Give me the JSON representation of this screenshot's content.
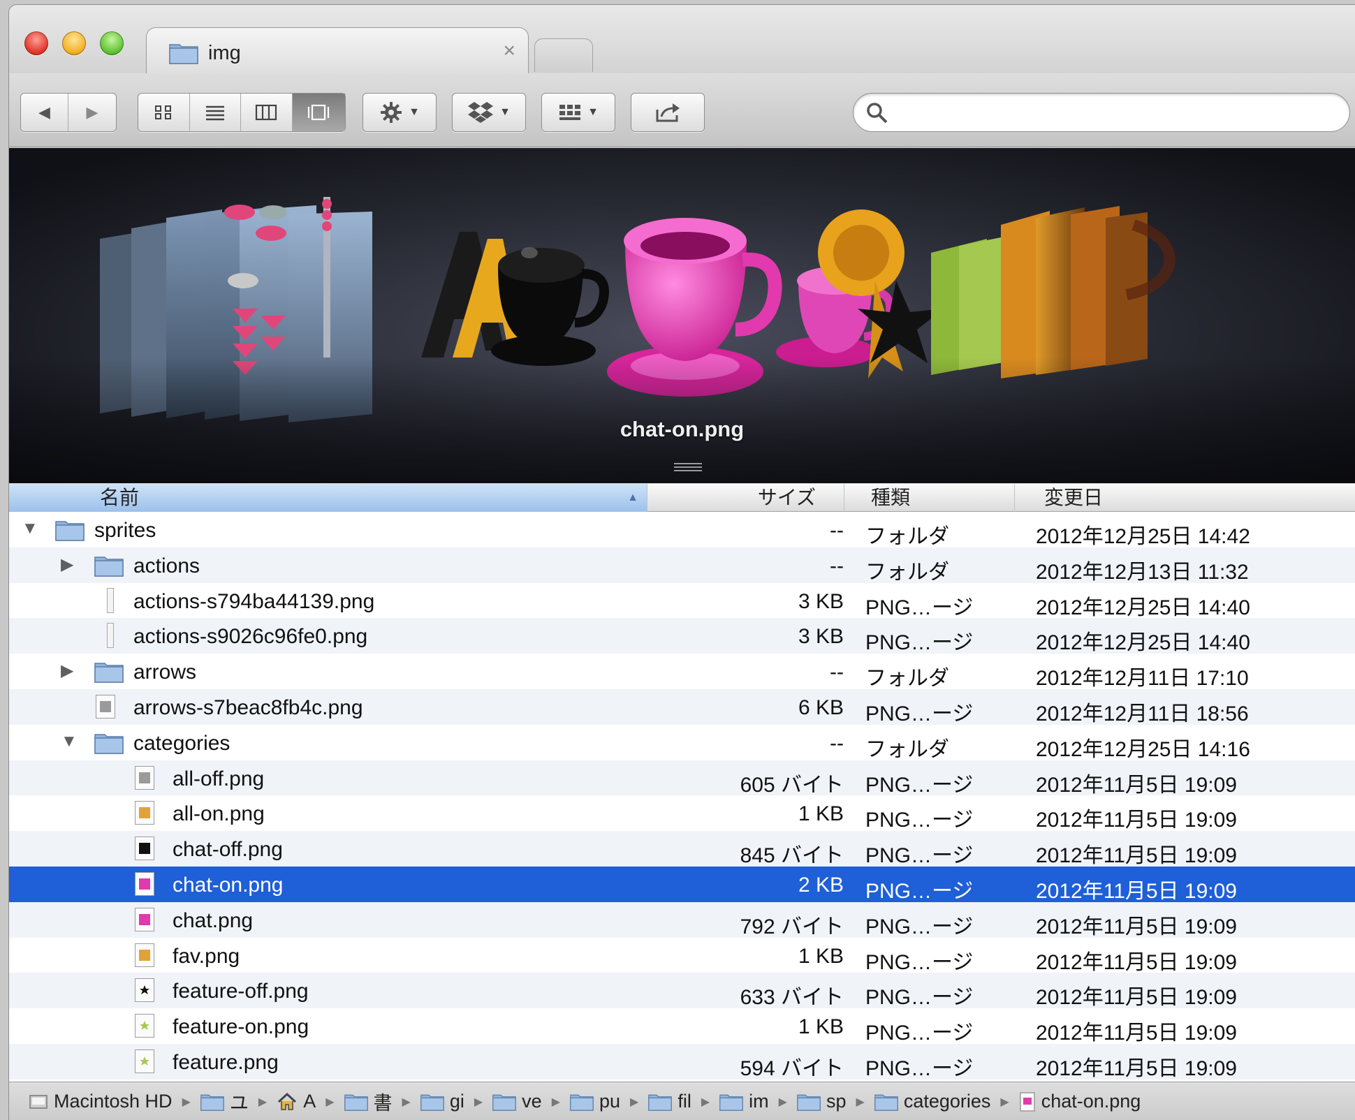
{
  "window": {
    "tab_title": "img",
    "tab_close": "×",
    "search_placeholder": ""
  },
  "toolbar": {
    "back": "◀",
    "forward": "▶",
    "view_icon": "icon-view-icon",
    "view_list": "list-view-icon",
    "view_column": "column-view-icon",
    "view_coverflow": "coverflow-view-icon",
    "action": "gear-icon",
    "dropbox": "dropbox-icon",
    "arrange": "arrange-icon",
    "share": "share-icon"
  },
  "coverflow": {
    "caption": "chat-on.png"
  },
  "columns": {
    "name": "名前",
    "size": "サイズ",
    "kind": "種類",
    "date": "変更日"
  },
  "rows": [
    {
      "level": 0,
      "disclosure": "▼",
      "icon": "folder",
      "name": "sprites",
      "size": "--",
      "kind": "フォルダ",
      "date": "2012年12月25日 14:42"
    },
    {
      "level": 1,
      "disclosure": "▶",
      "icon": "folder",
      "name": "actions",
      "size": "--",
      "kind": "フォルダ",
      "date": "2012年12月13日 11:32"
    },
    {
      "level": 1,
      "disclosure": "",
      "icon": "thin",
      "name": "actions-s794ba44139.png",
      "size": "3 KB",
      "kind": "PNG…ージ",
      "date": "2012年12月25日 14:40"
    },
    {
      "level": 1,
      "disclosure": "",
      "icon": "thin",
      "name": "actions-s9026c96fe0.png",
      "size": "3 KB",
      "kind": "PNG…ージ",
      "date": "2012年12月25日 14:40"
    },
    {
      "level": 1,
      "disclosure": "▶",
      "icon": "folder",
      "name": "arrows",
      "size": "--",
      "kind": "フォルダ",
      "date": "2012年12月11日 17:10"
    },
    {
      "level": 1,
      "disclosure": "",
      "icon": "file-gray",
      "name": "arrows-s7beac8fb4c.png",
      "size": "6 KB",
      "kind": "PNG…ージ",
      "date": "2012年12月11日 18:56"
    },
    {
      "level": 1,
      "disclosure": "▼",
      "icon": "folder",
      "name": "categories",
      "size": "--",
      "kind": "フォルダ",
      "date": "2012年12月25日 14:16"
    },
    {
      "level": 2,
      "disclosure": "",
      "icon": "file-gray",
      "name": "all-off.png",
      "size": "605 バイト",
      "kind": "PNG…ージ",
      "date": "2012年11月5日 19:09"
    },
    {
      "level": 2,
      "disclosure": "",
      "icon": "file-orange",
      "name": "all-on.png",
      "size": "1 KB",
      "kind": "PNG…ージ",
      "date": "2012年11月5日 19:09"
    },
    {
      "level": 2,
      "disclosure": "",
      "icon": "file-black",
      "name": "chat-off.png",
      "size": "845 バイト",
      "kind": "PNG…ージ",
      "date": "2012年11月5日 19:09"
    },
    {
      "level": 2,
      "disclosure": "",
      "icon": "file-pink",
      "name": "chat-on.png",
      "size": "2 KB",
      "kind": "PNG…ージ",
      "date": "2012年11月5日 19:09",
      "selected": true
    },
    {
      "level": 2,
      "disclosure": "",
      "icon": "file-pink",
      "name": "chat.png",
      "size": "792 バイト",
      "kind": "PNG…ージ",
      "date": "2012年11月5日 19:09"
    },
    {
      "level": 2,
      "disclosure": "",
      "icon": "file-orange",
      "name": "fav.png",
      "size": "1 KB",
      "kind": "PNG…ージ",
      "date": "2012年11月5日 19:09"
    },
    {
      "level": 2,
      "disclosure": "",
      "icon": "file-star-black",
      "name": "feature-off.png",
      "size": "633 バイト",
      "kind": "PNG…ージ",
      "date": "2012年11月5日 19:09"
    },
    {
      "level": 2,
      "disclosure": "",
      "icon": "file-star-green",
      "name": "feature-on.png",
      "size": "1 KB",
      "kind": "PNG…ージ",
      "date": "2012年11月5日 19:09"
    },
    {
      "level": 2,
      "disclosure": "",
      "icon": "file-star-green",
      "name": "feature.png",
      "size": "594 バイト",
      "kind": "PNG…ージ",
      "date": "2012年11月5日 19:09"
    }
  ],
  "pathbar": [
    {
      "icon": "hd",
      "label": "Macintosh HD"
    },
    {
      "icon": "folder",
      "label": "ユ"
    },
    {
      "icon": "home",
      "label": "A"
    },
    {
      "icon": "folder",
      "label": "書"
    },
    {
      "icon": "folder",
      "label": "gi"
    },
    {
      "icon": "folder",
      "label": "ve"
    },
    {
      "icon": "folder",
      "label": "pu"
    },
    {
      "icon": "folder",
      "label": "fil"
    },
    {
      "icon": "folder",
      "label": "im"
    },
    {
      "icon": "folder",
      "label": "sp"
    },
    {
      "icon": "folder",
      "label": "categories"
    },
    {
      "icon": "file",
      "label": "chat-on.png"
    }
  ],
  "colors": {
    "selection": "#1f5fd7",
    "folder": "#8fb5de",
    "cup_pink": "#e83fb4",
    "cup_black": "#0b0b0b",
    "coverflow_bg": "#2a2c36"
  }
}
